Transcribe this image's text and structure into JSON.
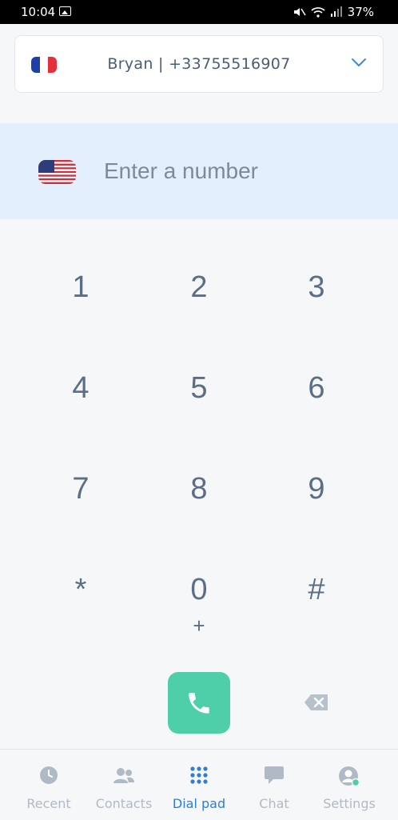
{
  "status_bar": {
    "time": "10:04",
    "battery": "37%"
  },
  "account": {
    "label": "Bryan | +33755516907",
    "flag": "france-flag-icon"
  },
  "number_entry": {
    "placeholder": "Enter a number",
    "flag": "us-flag-icon"
  },
  "keypad": {
    "k1": "1",
    "k2": "2",
    "k3": "3",
    "k4": "4",
    "k5": "5",
    "k6": "6",
    "k7": "7",
    "k8": "8",
    "k9": "9",
    "kstar": "*",
    "k0": "0",
    "k0_sub": "+",
    "khash": "#"
  },
  "nav": {
    "recent": "Recent",
    "contacts": "Contacts",
    "dialpad": "Dial pad",
    "chat": "Chat",
    "settings": "Settings"
  },
  "colors": {
    "accent": "#2e7ed9",
    "call": "#4fceaa",
    "entry_bg": "#e3effc"
  }
}
